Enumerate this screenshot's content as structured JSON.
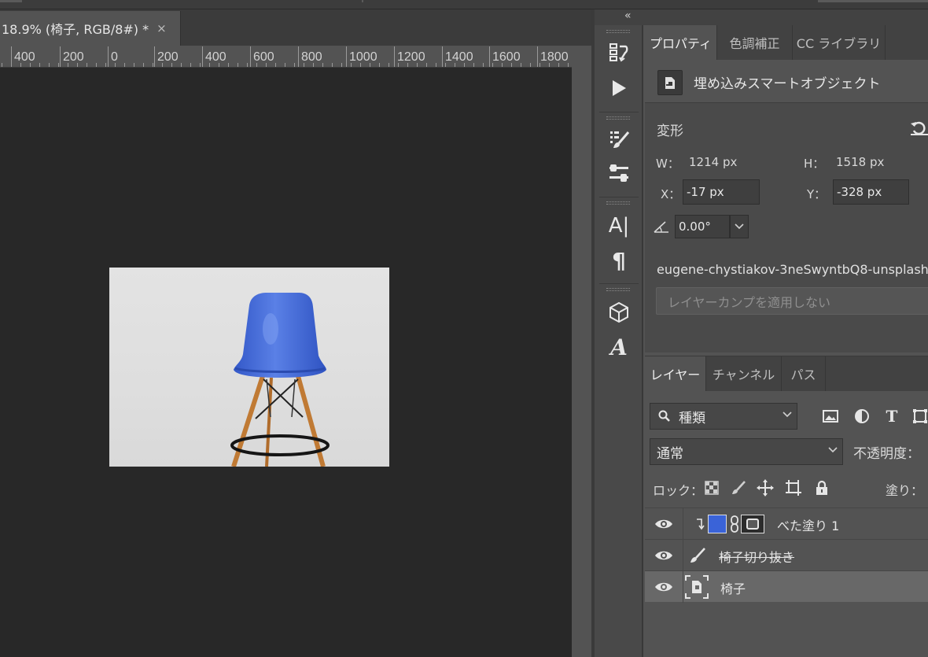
{
  "document": {
    "tab_title": "18.9% (椅子, RGB/8#) *",
    "tab_close": "×"
  },
  "ruler": {
    "labels": [
      "400",
      "200",
      "0",
      "200",
      "400",
      "600",
      "800",
      "1000",
      "1200",
      "1400",
      "1600",
      "1800"
    ]
  },
  "toolbar": {
    "collapse": "«",
    "icons": [
      "history-icon",
      "play-action-icon",
      "brush-settings-icon",
      "adjustments-icon",
      "character-icon",
      "paragraph-icon",
      "3d-cube-icon",
      "glyphs-icon"
    ],
    "character_glyph": "A|",
    "paragraph_glyph": "¶",
    "glyphs_glyph": "A"
  },
  "properties": {
    "tabs": [
      "プロパティ",
      "色調補正",
      "CC ライブラリ"
    ],
    "active_tab": "プロパティ",
    "object_type": "埋め込みスマートオブジェクト",
    "transform_heading": "変形",
    "w_label": "W：",
    "w_value": "1214 px",
    "h_label": "H：",
    "h_value": "1518 px",
    "x_label": "X：",
    "x_value": "-17 px",
    "y_label": "Y：",
    "y_value": "-328 px",
    "angle_value": "0.00°",
    "filename": "eugene-chystiakov-3neSwyntbQ8-unsplash",
    "layer_comp_placeholder": "レイヤーカンプを適用しない"
  },
  "layers": {
    "tabs": [
      "レイヤー",
      "チャンネル",
      "パス"
    ],
    "active_tab": "レイヤー",
    "filter_kind": "種類",
    "blend_mode": "通常",
    "opacity_label": "不透明度：",
    "lock_label": "ロック：",
    "fill_label": "塗り：",
    "items": [
      {
        "name": "べた塗り 1",
        "type": "solid-color",
        "visible": true,
        "clipped": true,
        "swatch": "#3a63d8"
      },
      {
        "name": "椅子切り抜き",
        "type": "brush",
        "visible": true
      },
      {
        "name": "椅子",
        "type": "smart-object",
        "visible": true,
        "selected": true
      }
    ]
  },
  "colors": {
    "chair_seat": "#3f66d6",
    "canvas_bg": "#282828",
    "panel_bg": "#535353"
  }
}
